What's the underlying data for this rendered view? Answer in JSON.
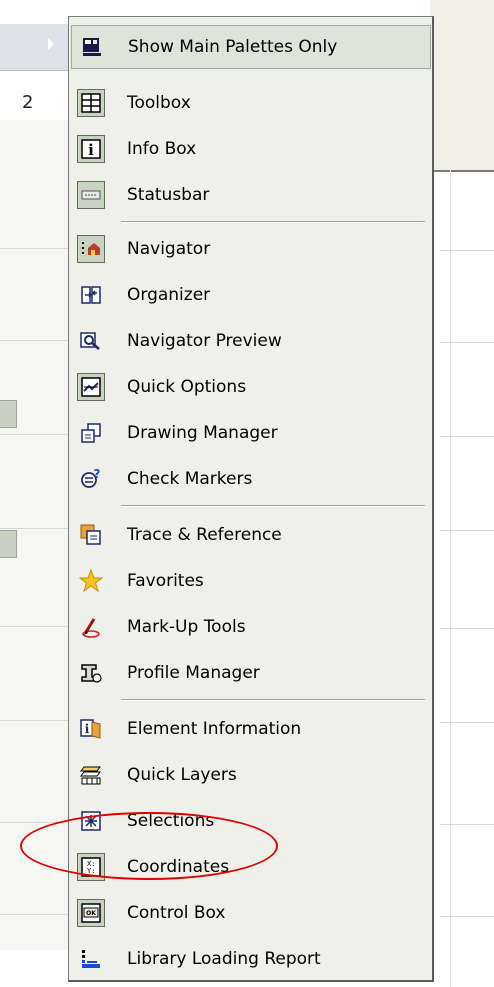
{
  "background": {
    "number_label": "2"
  },
  "menu": {
    "items": [
      {
        "label": "Show Main Palettes Only",
        "icon": "palettes-icon",
        "checked": false,
        "highlighted": true
      },
      {
        "label": "Toolbox",
        "icon": "toolbox-icon",
        "checked": true
      },
      {
        "label": "Info Box",
        "icon": "info-box-icon",
        "checked": true
      },
      {
        "label": "Statusbar",
        "icon": "statusbar-icon",
        "checked": true
      },
      {
        "label": "Navigator",
        "icon": "navigator-icon",
        "checked": true
      },
      {
        "label": "Organizer",
        "icon": "organizer-icon",
        "checked": false
      },
      {
        "label": "Navigator Preview",
        "icon": "navigator-preview-icon",
        "checked": false
      },
      {
        "label": "Quick Options",
        "icon": "quick-options-icon",
        "checked": true
      },
      {
        "label": "Drawing Manager",
        "icon": "drawing-manager-icon",
        "checked": false
      },
      {
        "label": "Check Markers",
        "icon": "check-markers-icon",
        "checked": false
      },
      {
        "label": "Trace & Reference",
        "icon": "trace-reference-icon",
        "checked": false
      },
      {
        "label": "Favorites",
        "icon": "favorites-star-icon",
        "checked": false
      },
      {
        "label": "Mark-Up Tools",
        "icon": "mark-up-tools-icon",
        "checked": false
      },
      {
        "label": "Profile Manager",
        "icon": "profile-manager-icon",
        "checked": false
      },
      {
        "label": "Element Information",
        "icon": "element-information-icon",
        "checked": false
      },
      {
        "label": "Quick Layers",
        "icon": "quick-layers-icon",
        "checked": false
      },
      {
        "label": "Selections",
        "icon": "selections-icon",
        "checked": false
      },
      {
        "label": "Coordinates",
        "icon": "coordinates-icon",
        "checked": true
      },
      {
        "label": "Control Box",
        "icon": "control-box-icon",
        "checked": true
      },
      {
        "label": "Library Loading Report",
        "icon": "library-loading-report-icon",
        "checked": false
      }
    ]
  },
  "colors": {
    "menu_bg": "#f0f0ea",
    "checked_bg": "#c9d3c1",
    "highlight_bg": "#dfe4d8",
    "annotation": "#e00000"
  }
}
